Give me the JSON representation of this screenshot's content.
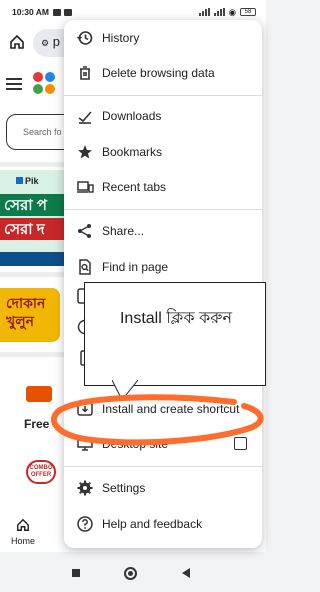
{
  "status_bar": {
    "time": "10:30 AM",
    "battery": "58"
  },
  "browser": {
    "tab_text": "p"
  },
  "page": {
    "search_placeholder": "Search fo",
    "banner_brand": "Pik",
    "banner_line1": "সেরা প",
    "banner_line2": "সেরা দ",
    "shop_card": "দোকান খুলুন",
    "free_text": "Free",
    "combo_badge": "COMBO OFFER"
  },
  "menu": {
    "items": [
      {
        "label": "History",
        "icon": "history-icon"
      },
      {
        "label": "Delete browsing data",
        "icon": "trash-icon"
      },
      {
        "label": "Downloads",
        "icon": "download-icon"
      },
      {
        "label": "Bookmarks",
        "icon": "star-icon"
      },
      {
        "label": "Recent tabs",
        "icon": "devices-icon"
      },
      {
        "label": "Share...",
        "icon": "share-icon"
      },
      {
        "label": "Find in page",
        "icon": "find-in-page-icon"
      },
      {
        "label": "Install and create shortcut",
        "icon": "install-icon"
      },
      {
        "label": "Desktop site",
        "icon": "monitor-icon",
        "checked": false
      },
      {
        "label": "Settings",
        "icon": "gear-icon"
      },
      {
        "label": "Help and feedback",
        "icon": "help-icon"
      }
    ]
  },
  "annotation": {
    "tooltip_text": "Install ক্লিক করুন",
    "highlight_color": "#ff6d2e"
  },
  "bottom_nav": {
    "home_label": "Home"
  },
  "colors": {
    "accent": "#1a73e8",
    "menu_bg": "#ffffff",
    "annotation": "#ff6d2e"
  }
}
